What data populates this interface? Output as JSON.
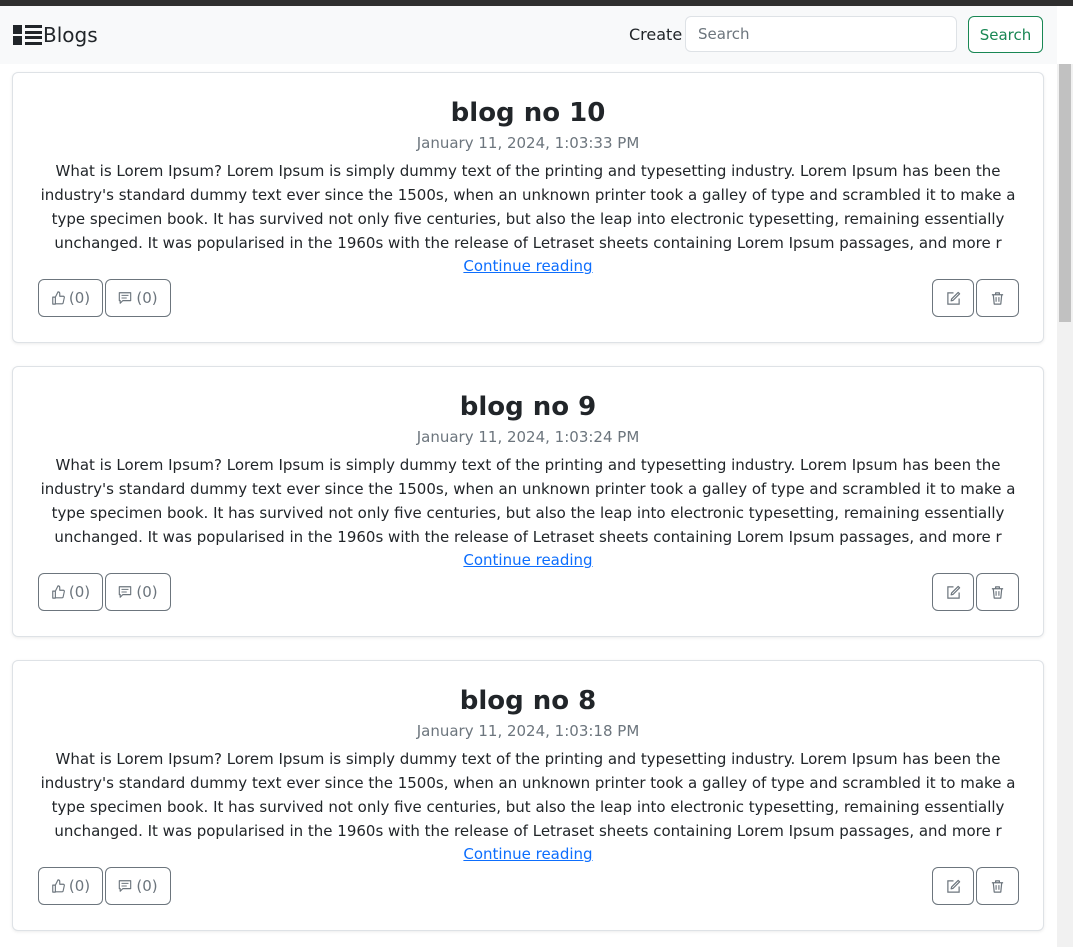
{
  "navbar": {
    "brand": "Blogs",
    "brand_icon": "list-layout-icon",
    "create_label": "Create",
    "search_placeholder": "Search",
    "search_button": "Search"
  },
  "colors": {
    "navbar_bg": "#f8f9fa",
    "search_button": "#198754",
    "link": "#0d6efd",
    "muted": "#6c757d"
  },
  "posts": [
    {
      "title": "blog no 10",
      "date": "January 11, 2024, 1:03:33 PM",
      "excerpt": "What is Lorem Ipsum? Lorem Ipsum is simply dummy text of the printing and typesetting industry. Lorem Ipsum has been the industry's standard dummy text ever since the 1500s, when an unknown printer took a galley of type and scrambled it to make a type specimen book. It has survived not only five centuries, but also the leap into electronic typesetting, remaining essentially unchanged. It was popularised in the 1960s with the release of Letraset sheets containing Lorem Ipsum passages, and more r",
      "read_more": "Continue reading",
      "likes": "(0)",
      "comments": "(0)"
    },
    {
      "title": "blog no 9",
      "date": "January 11, 2024, 1:03:24 PM",
      "excerpt": "What is Lorem Ipsum? Lorem Ipsum is simply dummy text of the printing and typesetting industry. Lorem Ipsum has been the industry's standard dummy text ever since the 1500s, when an unknown printer took a galley of type and scrambled it to make a type specimen book. It has survived not only five centuries, but also the leap into electronic typesetting, remaining essentially unchanged. It was popularised in the 1960s with the release of Letraset sheets containing Lorem Ipsum passages, and more r",
      "read_more": "Continue reading",
      "likes": "(0)",
      "comments": "(0)"
    },
    {
      "title": "blog no 8",
      "date": "January 11, 2024, 1:03:18 PM",
      "excerpt": "What is Lorem Ipsum? Lorem Ipsum is simply dummy text of the printing and typesetting industry. Lorem Ipsum has been the industry's standard dummy text ever since the 1500s, when an unknown printer took a galley of type and scrambled it to make a type specimen book. It has survived not only five centuries, but also the leap into electronic typesetting, remaining essentially unchanged. It was popularised in the 1960s with the release of Letraset sheets containing Lorem Ipsum passages, and more r",
      "read_more": "Continue reading",
      "likes": "(0)",
      "comments": "(0)"
    }
  ],
  "icons": {
    "like": "thumbs-up-icon",
    "comment": "comment-icon",
    "edit": "pencil-square-icon",
    "delete": "trash-icon"
  }
}
